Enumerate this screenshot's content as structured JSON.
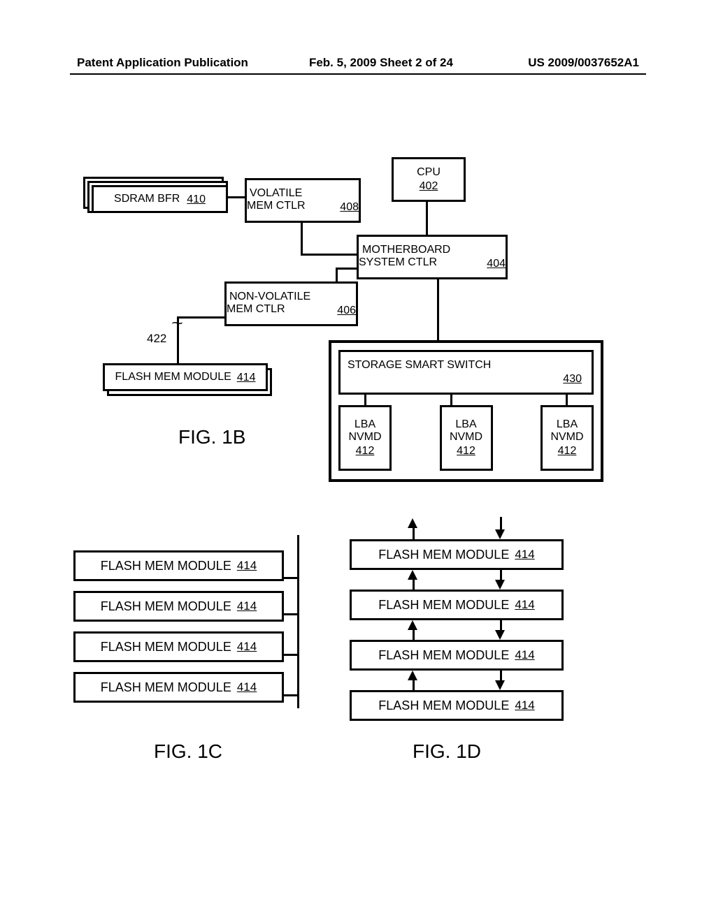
{
  "header": {
    "left": "Patent Application Publication",
    "mid": "Feb. 5, 2009  Sheet 2 of 24",
    "right": "US 2009/0037652A1"
  },
  "fig1b": {
    "cpu": {
      "label": "CPU",
      "ref": "402"
    },
    "motherboard": {
      "label1": "MOTHERBOARD",
      "label2": "SYSTEM CTLR",
      "ref": "404"
    },
    "volmem": {
      "label1": "VOLATILE",
      "label2": "MEM CTLR",
      "ref": "408"
    },
    "sdram": {
      "label": "SDRAM BFR",
      "ref": "410"
    },
    "nonvol": {
      "label1": "NON-VOLATILE",
      "label2": "MEM CTLR",
      "ref": "406"
    },
    "flashmod": {
      "label": "FLASH MEM MODULE",
      "ref": "414"
    },
    "busref": "422",
    "switch": {
      "label": "STORAGE SMART SWITCH",
      "ref": "430"
    },
    "lba": {
      "label1": "LBA",
      "label2": "NVMD",
      "ref": "412"
    },
    "fig_label": "FIG. 1B"
  },
  "fig1c": {
    "item": {
      "label": "FLASH MEM MODULE",
      "ref": "414"
    },
    "fig_label": "FIG. 1C"
  },
  "fig1d": {
    "item": {
      "label": "FLASH MEM MODULE",
      "ref": "414"
    },
    "fig_label": "FIG. 1D"
  }
}
